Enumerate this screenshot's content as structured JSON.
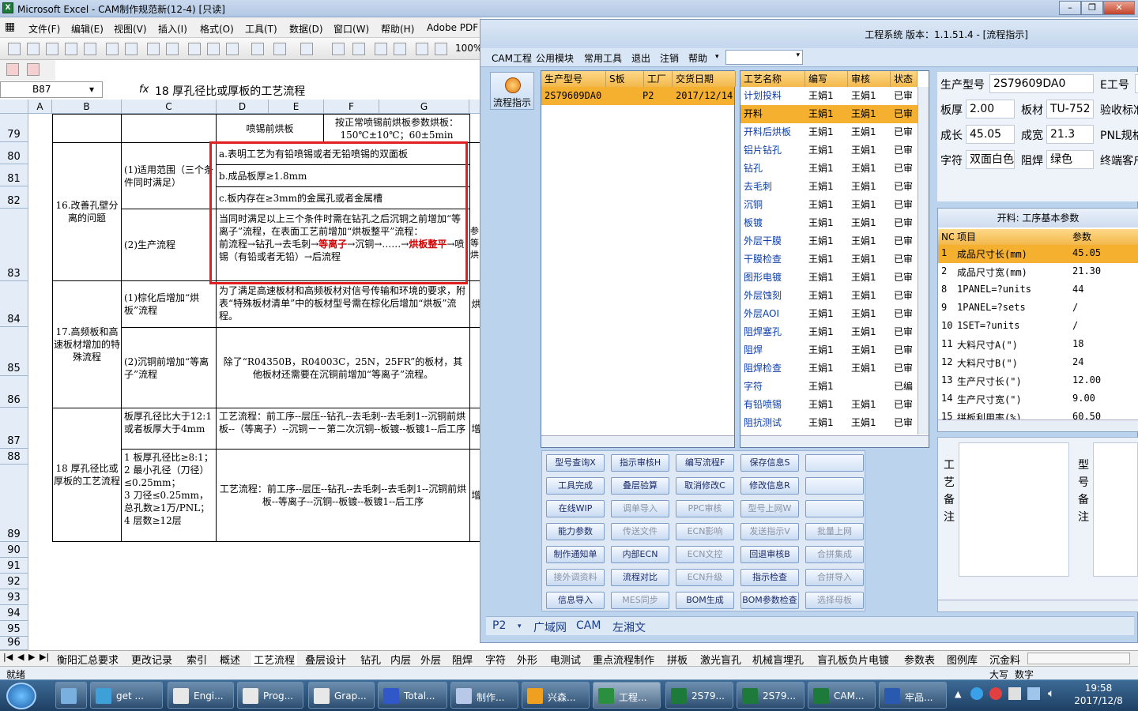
{
  "excel": {
    "title": "Microsoft Excel - CAM制作规范新(12-4)  [只读]",
    "menu": [
      "文件(F)",
      "编辑(E)",
      "视图(V)",
      "插入(I)",
      "格式(O)",
      "工具(T)",
      "数据(D)",
      "窗口(W)",
      "帮助(H)",
      "Adobe PDF"
    ],
    "zoom": "100%",
    "name_box": "B87",
    "fx": "fx",
    "formula": "18 厚孔径比或厚板的工艺流程",
    "columns": [
      "A",
      "B",
      "C",
      "D",
      "E",
      "F",
      "G"
    ],
    "rows": [
      "79",
      "80",
      "81",
      "82",
      "83",
      "84",
      "85",
      "86",
      "87",
      "88",
      "89",
      "90",
      "91",
      "92",
      "93",
      "94",
      "95",
      "96"
    ],
    "cells": {
      "r79_d": "喷锡前烘板",
      "r79_f": "按正常喷锡前烘板参数烘板：150℃±10℃；60±5min",
      "sec16": "16.改善孔壁分离的问题",
      "sec16_scope": "(1)适用范围（三个条件同时满足）",
      "cond_a": "a.表明工艺为有铅喷锡或者无铅喷锡的双面板",
      "cond_b": "b.成品板厚≥1.8mm",
      "cond_c": "c.板内存在≥3mm的金属孔或者金属槽",
      "sec16_flow": "(2)生产流程",
      "flow16_text": "当同时满足以上三个条件时需在钻孔之后沉铜之前增加“等离子”流程，在表面工艺前增加“烘板整平”流程：",
      "flow16_p1": "前流程→钻孔→去毛刺→",
      "flow16_red1": "等离子",
      "flow16_p2": "→沉铜→……→",
      "flow16_red2": "烘板整平",
      "flow16_p3": "→喷锡（有铅或者无铅）→后流程",
      "r83_g": "参等烘",
      "sec17": "17.高频板和高速板材增加的特殊流程",
      "sec17_a": "(1)棕化后增加“烘板”流程",
      "sec17_a_text": "为了满足高速板材和高频板材对信号传输和环境的要求，附表“特殊板材清单”中的板材型号需在棕化后增加“烘板”流程。",
      "r84_g": "烘",
      "sec17_b": "(2)沉铜前增加“等离子”流程",
      "sec17_b_text": "除了“R04350B，R04003C，25N，25FR”的板材，其他板材还需要在沉铜前增加“等离子”流程。",
      "sec18": "18 厚孔径比或厚板的工艺流程",
      "sec18_a": "板厚孔径比大于12:1或者板厚大于4mm",
      "sec18_a_text": "工艺流程：前工序--层压--钻孔--去毛刺--去毛刺1--沉铜前烘板--（等离子）--沉铜－－第二次沉铜--板镀--板镀1--后工序",
      "r87_g": "增",
      "sec18_b": "1 板厚孔径比≥8:1；\n2 最小孔径（刀径）≤0.25mm；\n3 刀径≤0.25mm，总孔数≥1万/PNL；\n4 层数≥12层",
      "sec18_b_text": "工艺流程：前工序--层压--钻孔--去毛刺--去毛刺1--沉铜前烘板--等离子--沉铜--板镀--板镀1--后工序",
      "r88_g": "增"
    },
    "sheet_tabs": [
      "衡阳汇总要求",
      "更改记录",
      "索引",
      "概述",
      "工艺流程",
      "叠层设计",
      "钻孔",
      "内层",
      "外层",
      "阻焊",
      "字符",
      "外形",
      "电测试",
      "重点流程制作",
      "拼板",
      "激光盲孔",
      "机械盲埋孔",
      "盲孔板负片电镀",
      "参数表",
      "图例库",
      "沉金料"
    ],
    "status_left": "就绪",
    "status_caps": "大写",
    "status_num": "数字"
  },
  "cam": {
    "title": "工程系统   版本：1.1.51.4 - [流程指示]",
    "menu": [
      "CAM工程",
      "公用模块",
      "常用工具",
      "退出",
      "注销",
      "帮助"
    ],
    "flow_button": "流程指示",
    "orders": {
      "headers": [
        "生产型号",
        "S板",
        "工厂",
        "交货日期"
      ],
      "rows": [
        [
          "2S79609DA0",
          "",
          "P2",
          "2017/12/14"
        ]
      ]
    },
    "process": {
      "headers": [
        "工艺名称",
        "编写",
        "审核",
        "状态"
      ],
      "rows": [
        [
          "计划投料",
          "王娟1",
          "王娟1",
          "已审"
        ],
        [
          "开料",
          "王娟1",
          "王娟1",
          "已审"
        ],
        [
          "开料后烘板",
          "王娟1",
          "王娟1",
          "已审"
        ],
        [
          "铝片钻孔",
          "王娟1",
          "王娟1",
          "已审"
        ],
        [
          "钻孔",
          "王娟1",
          "王娟1",
          "已审"
        ],
        [
          "去毛刺",
          "王娟1",
          "王娟1",
          "已审"
        ],
        [
          "沉铜",
          "王娟1",
          "王娟1",
          "已审"
        ],
        [
          "板镀",
          "王娟1",
          "王娟1",
          "已审"
        ],
        [
          "外层干膜",
          "王娟1",
          "王娟1",
          "已审"
        ],
        [
          "干膜检查",
          "王娟1",
          "王娟1",
          "已审"
        ],
        [
          "图形电镀",
          "王娟1",
          "王娟1",
          "已审"
        ],
        [
          "外层蚀刻",
          "王娟1",
          "王娟1",
          "已审"
        ],
        [
          "外层AOI",
          "王娟1",
          "王娟1",
          "已审"
        ],
        [
          "阻焊塞孔",
          "王娟1",
          "王娟1",
          "已审"
        ],
        [
          "阻焊",
          "王娟1",
          "王娟1",
          "已审"
        ],
        [
          "阻焊检查",
          "王娟1",
          "王娟1",
          "已审"
        ],
        [
          "字符",
          "王娟1",
          "",
          "已编"
        ],
        [
          "有铅喷锡",
          "王娟1",
          "王娟1",
          "已审"
        ],
        [
          "阻抗测试",
          "王娟1",
          "王娟1",
          "已审"
        ]
      ],
      "selected": 1
    },
    "buttons": [
      [
        "型号查询X",
        "指示审核H",
        "编写流程F",
        "保存信息S",
        ""
      ],
      [
        "工具完成",
        "叠层验算",
        "取消修改C",
        "修改信息R",
        ""
      ],
      [
        "在线WIP",
        "调单导入",
        "PPC审核",
        "型号上网W",
        ""
      ],
      [
        "能力参数",
        "传送文件",
        "ECN影响",
        "发送指示V",
        "批量上网"
      ],
      [
        "制作通知单",
        "内部ECN",
        "ECN文控",
        "回退审核B",
        "合拼集成"
      ],
      [
        "接外调资料",
        "流程对比",
        "ECN升级",
        "指示检查",
        "合拼导入"
      ],
      [
        "信息导入",
        "MES同步",
        "BOM生成",
        "BOM参数检查",
        "选择母板"
      ]
    ],
    "buttons_disabled": [
      [
        false,
        false,
        false,
        false,
        false
      ],
      [
        false,
        false,
        false,
        false,
        false
      ],
      [
        false,
        true,
        true,
        true,
        false
      ],
      [
        false,
        true,
        true,
        true,
        true
      ],
      [
        false,
        false,
        true,
        false,
        true
      ],
      [
        true,
        false,
        true,
        false,
        true
      ],
      [
        false,
        true,
        false,
        false,
        true
      ]
    ],
    "bottom": {
      "factory": "P2",
      "tabs": [
        "广域网",
        "CAM",
        "左湘文"
      ]
    },
    "info": {
      "part_label": "生产型号",
      "part": "2S79609DA0",
      "eng_label": "E工号",
      "thick_label": "板厚",
      "thick": "2.00",
      "mat_label": "板材",
      "mat": "TU-752",
      "accept_label": "验收标准",
      "len_label": "成长",
      "len": "45.05",
      "wid_label": "成宽",
      "wid": "21.3",
      "pnl_label": "PNL规格",
      "char_label": "字符",
      "char": "双面白色",
      "mask_label": "阻焊",
      "mask": "绿色",
      "cust_label": "终端客户"
    },
    "params": {
      "title": "开料: 工序基本参数",
      "headers": [
        "NO",
        "项目",
        "参数"
      ],
      "rows": [
        [
          "1",
          "成品尺寸长(mm)",
          "45.05"
        ],
        [
          "2",
          "成品尺寸宽(mm)",
          "21.30"
        ],
        [
          "8",
          "1PANEL=?units",
          "44"
        ],
        [
          "9",
          "1PANEL=?sets",
          "/"
        ],
        [
          "10",
          "1SET=?units",
          "/"
        ],
        [
          "11",
          "大料尺寸A(\")",
          "18"
        ],
        [
          "12",
          "大料尺寸B(\")",
          "24"
        ],
        [
          "13",
          "生产尺寸长(\")",
          "12.00"
        ],
        [
          "14",
          "生产尺寸宽(\")",
          "9.00"
        ],
        [
          "15",
          "拼板利用率(%)",
          "60.50"
        ]
      ]
    },
    "notes": {
      "process_label": "工\n艺\n备\n注",
      "model_label": "型\n号\n备\n注"
    }
  },
  "taskbar": {
    "items": [
      "",
      "get ...",
      "Engi...",
      "Prog...",
      "Grap...",
      "Total...",
      "制作...",
      "兴森...",
      "工程...",
      "2S79...",
      "2S79...",
      "CAM...",
      "牢品..."
    ],
    "time": "19:58",
    "date": "2017/12/8"
  }
}
